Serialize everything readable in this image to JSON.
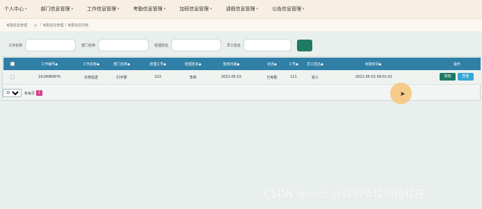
{
  "nav": {
    "items": [
      {
        "label": "个人中心"
      },
      {
        "label": "部门信息管理"
      },
      {
        "label": "工作信息管理"
      },
      {
        "label": "考勤信息管理"
      },
      {
        "label": "加班信息管理"
      },
      {
        "label": "请假信息管理"
      },
      {
        "label": "公告信息管理"
      }
    ],
    "caret": "▾"
  },
  "breadcrumb": {
    "section": "考勤信息管理",
    "home_icon": "⌂",
    "path_1": "考勤信息管理",
    "path_2": "考勤信息列表",
    "sep": "/"
  },
  "search": {
    "fields": [
      {
        "label": "工作名称",
        "value": ""
      },
      {
        "label": "部门名称",
        "value": ""
      },
      {
        "label": "经理姓名",
        "value": ""
      },
      {
        "label": "员工姓名",
        "value": ""
      }
    ],
    "button_icon": "search-icon"
  },
  "table": {
    "columns": [
      "工作编号◆",
      "工作名称◆",
      "部门名称◆",
      "经理工号◆",
      "经理姓名◆",
      "签到日期◆",
      "状态◆",
      "工号◆",
      "员工姓名◆",
      "考勤时间◆",
      "操作"
    ],
    "rows": [
      {
        "cells": [
          "1619080676",
          "日常巡逻",
          "打手部",
          "222",
          "李四",
          "2021-05-02",
          "已考勤",
          "111",
          "张三",
          "2021-05-02 09:01:01"
        ],
        "detail_label": "加班",
        "view_label": "查看"
      }
    ]
  },
  "pager": {
    "page_size": "10",
    "per_label": "条每页",
    "current_page": "1"
  },
  "watermark": {
    "text": "CSDN @一念 计算机毕设源码程序"
  },
  "colors": {
    "header_bg": "#2f7fa6",
    "primary": "#1e7a63",
    "view_button": "#36a6d6",
    "page_active": "#d63a8b",
    "nav_bg": "#f7efe3"
  }
}
